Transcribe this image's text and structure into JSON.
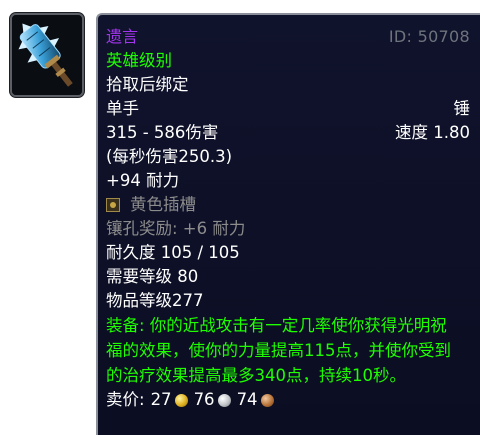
{
  "item": {
    "name": "遗言",
    "id": "ID: 50708",
    "difficulty": "英雄级别",
    "bind": "拾取后绑定",
    "slot": "单手",
    "type": "锤",
    "damage": "315 - 586伤害",
    "speed": "速度 1.80",
    "dps": "(每秒伤害250.3)",
    "stamina": "+94 耐力",
    "socket": "黄色插槽",
    "socket_bonus": "镶孔奖励: +6 耐力",
    "durability": "耐久度 105 / 105",
    "required_level": "需要等级 80",
    "item_level": "物品等级277",
    "equip_effect": "装备: 你的近战攻击有一定几率使你获得光明祝福的效果，使你的力量提高115点，并使你受到的治疗效果提高最多340点，持续10秒。",
    "sell_label": "卖价:",
    "sell_gold": "27",
    "sell_silver": "76",
    "sell_copper": "74",
    "icon": "mace-icon"
  },
  "colors": {
    "epic": "#a335ee",
    "green": "#1eff00",
    "tooltip_bg": "#0d0f26",
    "border": "#8a8f99"
  }
}
